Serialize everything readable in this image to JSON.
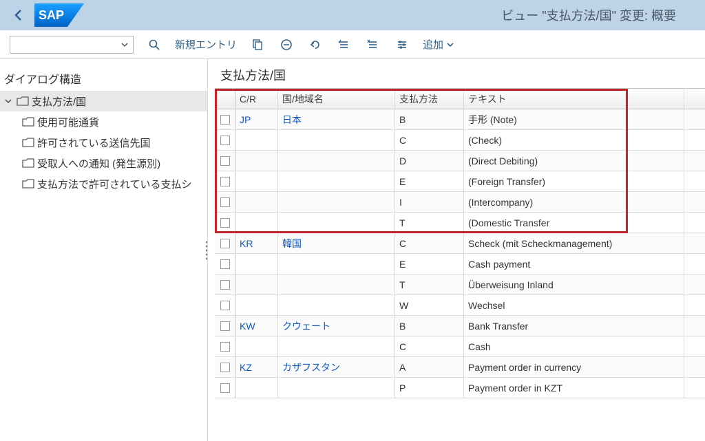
{
  "header": {
    "title": "ビュー \"支払方法/国\" 変更: 概要"
  },
  "toolbar": {
    "new_entry": "新規エントリ",
    "add": "追加"
  },
  "tree": {
    "title": "ダイアログ構造",
    "root": "支払方法/国",
    "items": [
      "使用可能通貨",
      "許可されている送信先国",
      "受取人への通知 (発生源別)",
      "支払方法で許可されている支払シ"
    ]
  },
  "section_title": "支払方法/国",
  "columns": {
    "cr": "C/R",
    "region": "国/地域名",
    "method": "支払方法",
    "text": "テキスト"
  },
  "rows": [
    {
      "cr": "JP",
      "region": "日本",
      "method": "B",
      "text": "手形 (Note)",
      "is_link": true,
      "hl": true
    },
    {
      "cr": "",
      "region": "",
      "method": "C",
      "text": "(Check)",
      "is_link": false,
      "hl": true
    },
    {
      "cr": "",
      "region": "",
      "method": "D",
      "text": " (Direct Debiting)",
      "is_link": false,
      "hl": true
    },
    {
      "cr": "",
      "region": "",
      "method": "E",
      "text": "(Foreign Transfer)",
      "is_link": false,
      "hl": true
    },
    {
      "cr": "",
      "region": "",
      "method": "I",
      "text": " (Intercompany)",
      "is_link": false,
      "hl": true
    },
    {
      "cr": "",
      "region": "",
      "method": "T",
      "text": " (Domestic Transfer",
      "is_link": false,
      "hl": true
    },
    {
      "cr": "KR",
      "region": "韓国",
      "method": "C",
      "text": "Scheck (mit Scheckmanagement)",
      "is_link": true,
      "hl": false
    },
    {
      "cr": "",
      "region": "",
      "method": "E",
      "text": "Cash payment",
      "is_link": false,
      "hl": false
    },
    {
      "cr": "",
      "region": "",
      "method": "T",
      "text": "Überweisung Inland",
      "is_link": false,
      "hl": false
    },
    {
      "cr": "",
      "region": "",
      "method": "W",
      "text": "Wechsel",
      "is_link": false,
      "hl": false
    },
    {
      "cr": "KW",
      "region": "クウェート",
      "method": "B",
      "text": "Bank Transfer",
      "is_link": true,
      "hl": false
    },
    {
      "cr": "",
      "region": "",
      "method": "C",
      "text": "Cash",
      "is_link": false,
      "hl": false
    },
    {
      "cr": "KZ",
      "region": "カザフスタン",
      "method": "A",
      "text": "Payment order in currency",
      "is_link": true,
      "hl": false
    },
    {
      "cr": "",
      "region": "",
      "method": "P",
      "text": "Payment order in KZT",
      "is_link": false,
      "hl": false
    }
  ]
}
